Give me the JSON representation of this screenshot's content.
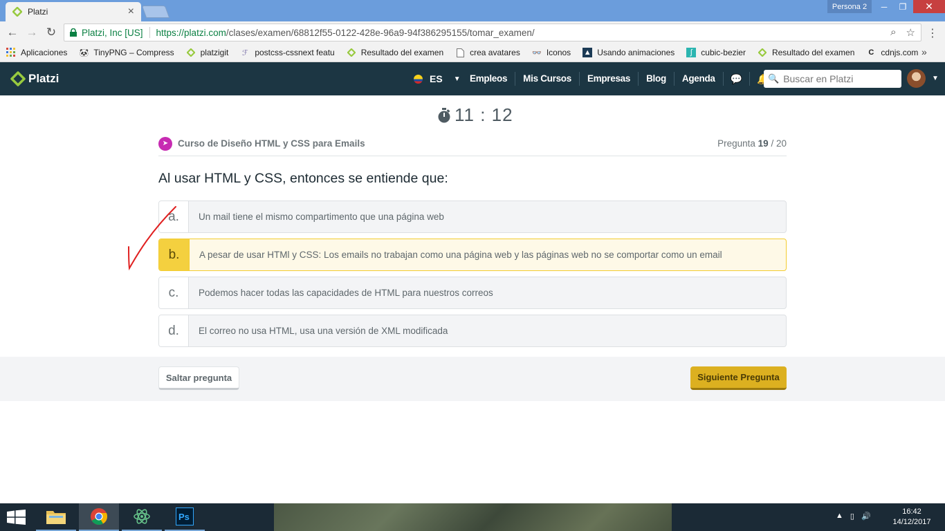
{
  "browser": {
    "tab_title": "Platzi",
    "persona": "Persona 2",
    "secure_label": "Platzi, Inc [US]",
    "url_host": "https://platzi.com",
    "url_path": "/clases/examen/68812f55-0122-428e-96a9-94f386295155/tomar_examen/",
    "bookmarks": [
      {
        "label": "Aplicaciones",
        "icon": "apps-grid-icon"
      },
      {
        "label": "TinyPNG – Compress",
        "icon": "panda-icon"
      },
      {
        "label": "platzigit",
        "icon": "platzi-icon"
      },
      {
        "label": "postcss-cssnext featu",
        "icon": "postcss-icon"
      },
      {
        "label": "Resultado del examen",
        "icon": "platzi-icon"
      },
      {
        "label": "crea avatares",
        "icon": "page-icon"
      },
      {
        "label": "Iconos",
        "icon": "glasses-icon"
      },
      {
        "label": "Usando animaciones",
        "icon": "mdn-icon"
      },
      {
        "label": "cubic-bezier",
        "icon": "curve-icon"
      },
      {
        "label": "Resultado del examen",
        "icon": "platzi-icon"
      },
      {
        "label": "cdnjs.com",
        "icon": "cdnjs-icon"
      }
    ]
  },
  "site": {
    "brand": "Platzi",
    "lang": "ES",
    "nav": [
      "Empleos",
      "Mis Cursos",
      "Empresas",
      "Blog",
      "Agenda"
    ],
    "search_placeholder": "Buscar en Platzi"
  },
  "exam": {
    "timer": "11 : 12",
    "course": "Curso de Diseño HTML y CSS para Emails",
    "question_label": "Pregunta",
    "question_current": "19",
    "question_total": "/ 20",
    "question": "Al usar HTML y CSS, entonces se entiende que:",
    "options": [
      {
        "letter": "a.",
        "text": "Un mail tiene el mismo compartimento que una página web",
        "selected": false
      },
      {
        "letter": "b.",
        "text": "A pesar de usar HTMl y CSS: Los emails no trabajan como una página web y las páginas web no se comportar como un email",
        "selected": true
      },
      {
        "letter": "c.",
        "text": "Podemos hacer todas las capacidades de HTML para nuestros correos",
        "selected": false
      },
      {
        "letter": "d.",
        "text": "El correo no usa HTML, usa una versión de XML modificada",
        "selected": false
      }
    ],
    "skip_label": "Saltar pregunta",
    "next_label": "Siguiente Pregunta"
  },
  "taskbar": {
    "time": "16:42",
    "date": "14/12/2017"
  },
  "colors": {
    "header_bg": "#1c3643",
    "accent_green": "#98ca3f",
    "selected_yellow": "#f4d03f",
    "next_button": "#dcb020"
  }
}
